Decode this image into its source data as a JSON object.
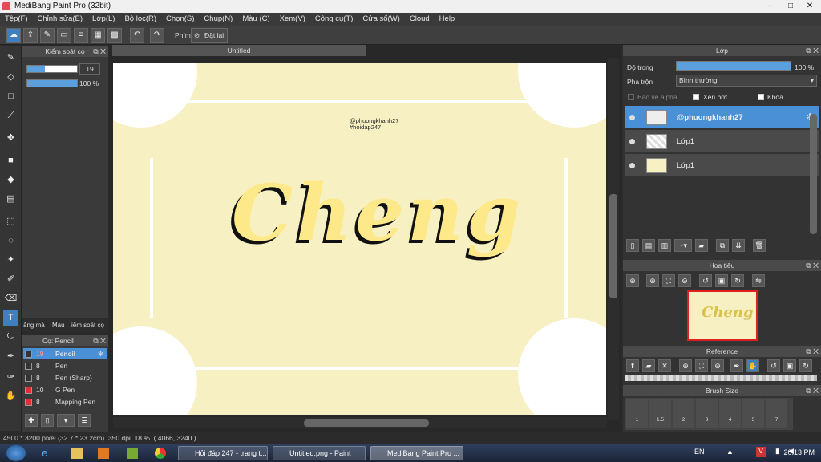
{
  "app": {
    "title": "MediBang Paint Pro (32bit)"
  },
  "menu": [
    "Tệp(F)",
    "Chỉnh sửa(E)",
    "Lớp(L)",
    "Bộ lọc(R)",
    "Chọn(S)",
    "Chụp(N)",
    "Màu (C)",
    "Xem(V)",
    "Công cụ(T)",
    "Cửa sổ(W)",
    "Cloud",
    "Help"
  ],
  "toolbar": {
    "key_label": "Phím",
    "reset_label": "Đặt lại"
  },
  "brush_control": {
    "title": "Kiểm soát cọ",
    "size_value": "19",
    "opacity_value": "100 %",
    "size_fill": 0.35,
    "opacity_fill": 1.0
  },
  "left_tabs": [
    "ảng mà",
    "Màu",
    "iểm soát cọ"
  ],
  "brush_list": {
    "title": "Cọ: Pencil",
    "items": [
      {
        "size": "19",
        "name": "Pencil",
        "color": "#333333"
      },
      {
        "size": "8",
        "name": "Pen",
        "color": "#333333"
      },
      {
        "size": "8",
        "name": "Pen (Sharp)",
        "color": "#333333"
      },
      {
        "size": "10",
        "name": "G Pen",
        "color": "#e03030"
      },
      {
        "size": "8",
        "name": "Mapping Pen",
        "color": "#e03030"
      }
    ]
  },
  "document": {
    "tab": "Untitled",
    "watermark_line1": "@phuongkhanh27",
    "watermark_line2": "#hoidap247",
    "art_text": "Cheng"
  },
  "status": {
    "dimensions": "4500 * 3200 pixel",
    "size_cm": "(32.7 * 23.2cm)",
    "dpi": "350 dpi",
    "zoom": "18 %",
    "coords": "( 4066, 3240 )"
  },
  "layer_panel": {
    "title": "Lớp",
    "opacity_label": "Độ trong",
    "opacity_value": "100 %",
    "blend_label": "Pha trộn",
    "blend_value": "Bình thường",
    "protect_alpha": "Bảo vệ alpha",
    "clipping": "Xén bớt",
    "lock": "Khóa",
    "layers": [
      {
        "name": "@phuongkhanh27",
        "selected": true
      },
      {
        "name": "Lớp1",
        "selected": false
      },
      {
        "name": "Lớp1",
        "selected": false
      }
    ]
  },
  "navigator": {
    "title": "Hoa tiêu"
  },
  "reference": {
    "title": "Reference"
  },
  "brush_size": {
    "title": "Brush Size",
    "sizes": [
      "1",
      "1.5",
      "2",
      "3",
      "4",
      "5",
      "7"
    ]
  },
  "taskbar": {
    "items": [
      "Hỏi đáp 247 - trang t...",
      "Untitled.png - Paint",
      "MediBang Paint Pro ..."
    ],
    "lang": "EN",
    "clock": "20:13 PM"
  }
}
